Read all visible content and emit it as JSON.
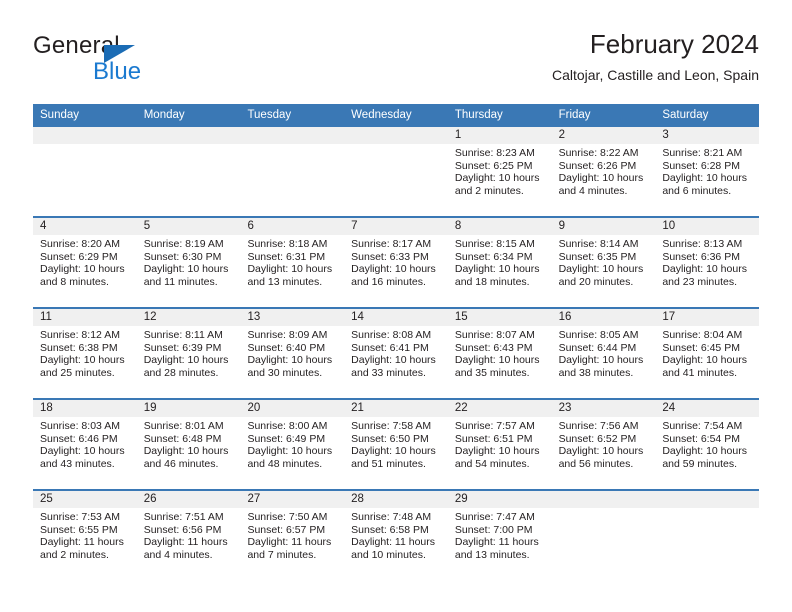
{
  "brand": {
    "name_top": "General",
    "name_bottom": "Blue",
    "triangle_color": "#1b6cb5",
    "blue_text_color": "#1b7ad0"
  },
  "header": {
    "title": "February 2024",
    "location": "Caltojar, Castille and Leon, Spain"
  },
  "theme": {
    "header_blue": "#3a78b5",
    "day_strip_gray": "#f0f0f0",
    "text_color": "#231f20"
  },
  "labels": {
    "sunrise_prefix": "Sunrise:",
    "sunset_prefix": "Sunset:",
    "daylight_prefix": "Daylight:"
  },
  "weekdays": [
    "Sunday",
    "Monday",
    "Tuesday",
    "Wednesday",
    "Thursday",
    "Friday",
    "Saturday"
  ],
  "weeks": [
    [
      {
        "day": "",
        "empty": true
      },
      {
        "day": "",
        "empty": true
      },
      {
        "day": "",
        "empty": true
      },
      {
        "day": "",
        "empty": true
      },
      {
        "day": "1",
        "sunrise": "Sunrise: 8:23 AM",
        "sunset": "Sunset: 6:25 PM",
        "daylight": "Daylight: 10 hours and 2 minutes."
      },
      {
        "day": "2",
        "sunrise": "Sunrise: 8:22 AM",
        "sunset": "Sunset: 6:26 PM",
        "daylight": "Daylight: 10 hours and 4 minutes."
      },
      {
        "day": "3",
        "sunrise": "Sunrise: 8:21 AM",
        "sunset": "Sunset: 6:28 PM",
        "daylight": "Daylight: 10 hours and 6 minutes."
      }
    ],
    [
      {
        "day": "4",
        "sunrise": "Sunrise: 8:20 AM",
        "sunset": "Sunset: 6:29 PM",
        "daylight": "Daylight: 10 hours and 8 minutes."
      },
      {
        "day": "5",
        "sunrise": "Sunrise: 8:19 AM",
        "sunset": "Sunset: 6:30 PM",
        "daylight": "Daylight: 10 hours and 11 minutes."
      },
      {
        "day": "6",
        "sunrise": "Sunrise: 8:18 AM",
        "sunset": "Sunset: 6:31 PM",
        "daylight": "Daylight: 10 hours and 13 minutes."
      },
      {
        "day": "7",
        "sunrise": "Sunrise: 8:17 AM",
        "sunset": "Sunset: 6:33 PM",
        "daylight": "Daylight: 10 hours and 16 minutes."
      },
      {
        "day": "8",
        "sunrise": "Sunrise: 8:15 AM",
        "sunset": "Sunset: 6:34 PM",
        "daylight": "Daylight: 10 hours and 18 minutes."
      },
      {
        "day": "9",
        "sunrise": "Sunrise: 8:14 AM",
        "sunset": "Sunset: 6:35 PM",
        "daylight": "Daylight: 10 hours and 20 minutes."
      },
      {
        "day": "10",
        "sunrise": "Sunrise: 8:13 AM",
        "sunset": "Sunset: 6:36 PM",
        "daylight": "Daylight: 10 hours and 23 minutes."
      }
    ],
    [
      {
        "day": "11",
        "sunrise": "Sunrise: 8:12 AM",
        "sunset": "Sunset: 6:38 PM",
        "daylight": "Daylight: 10 hours and 25 minutes."
      },
      {
        "day": "12",
        "sunrise": "Sunrise: 8:11 AM",
        "sunset": "Sunset: 6:39 PM",
        "daylight": "Daylight: 10 hours and 28 minutes."
      },
      {
        "day": "13",
        "sunrise": "Sunrise: 8:09 AM",
        "sunset": "Sunset: 6:40 PM",
        "daylight": "Daylight: 10 hours and 30 minutes."
      },
      {
        "day": "14",
        "sunrise": "Sunrise: 8:08 AM",
        "sunset": "Sunset: 6:41 PM",
        "daylight": "Daylight: 10 hours and 33 minutes."
      },
      {
        "day": "15",
        "sunrise": "Sunrise: 8:07 AM",
        "sunset": "Sunset: 6:43 PM",
        "daylight": "Daylight: 10 hours and 35 minutes."
      },
      {
        "day": "16",
        "sunrise": "Sunrise: 8:05 AM",
        "sunset": "Sunset: 6:44 PM",
        "daylight": "Daylight: 10 hours and 38 minutes."
      },
      {
        "day": "17",
        "sunrise": "Sunrise: 8:04 AM",
        "sunset": "Sunset: 6:45 PM",
        "daylight": "Daylight: 10 hours and 41 minutes."
      }
    ],
    [
      {
        "day": "18",
        "sunrise": "Sunrise: 8:03 AM",
        "sunset": "Sunset: 6:46 PM",
        "daylight": "Daylight: 10 hours and 43 minutes."
      },
      {
        "day": "19",
        "sunrise": "Sunrise: 8:01 AM",
        "sunset": "Sunset: 6:48 PM",
        "daylight": "Daylight: 10 hours and 46 minutes."
      },
      {
        "day": "20",
        "sunrise": "Sunrise: 8:00 AM",
        "sunset": "Sunset: 6:49 PM",
        "daylight": "Daylight: 10 hours and 48 minutes."
      },
      {
        "day": "21",
        "sunrise": "Sunrise: 7:58 AM",
        "sunset": "Sunset: 6:50 PM",
        "daylight": "Daylight: 10 hours and 51 minutes."
      },
      {
        "day": "22",
        "sunrise": "Sunrise: 7:57 AM",
        "sunset": "Sunset: 6:51 PM",
        "daylight": "Daylight: 10 hours and 54 minutes."
      },
      {
        "day": "23",
        "sunrise": "Sunrise: 7:56 AM",
        "sunset": "Sunset: 6:52 PM",
        "daylight": "Daylight: 10 hours and 56 minutes."
      },
      {
        "day": "24",
        "sunrise": "Sunrise: 7:54 AM",
        "sunset": "Sunset: 6:54 PM",
        "daylight": "Daylight: 10 hours and 59 minutes."
      }
    ],
    [
      {
        "day": "25",
        "sunrise": "Sunrise: 7:53 AM",
        "sunset": "Sunset: 6:55 PM",
        "daylight": "Daylight: 11 hours and 2 minutes."
      },
      {
        "day": "26",
        "sunrise": "Sunrise: 7:51 AM",
        "sunset": "Sunset: 6:56 PM",
        "daylight": "Daylight: 11 hours and 4 minutes."
      },
      {
        "day": "27",
        "sunrise": "Sunrise: 7:50 AM",
        "sunset": "Sunset: 6:57 PM",
        "daylight": "Daylight: 11 hours and 7 minutes."
      },
      {
        "day": "28",
        "sunrise": "Sunrise: 7:48 AM",
        "sunset": "Sunset: 6:58 PM",
        "daylight": "Daylight: 11 hours and 10 minutes."
      },
      {
        "day": "29",
        "sunrise": "Sunrise: 7:47 AM",
        "sunset": "Sunset: 7:00 PM",
        "daylight": "Daylight: 11 hours and 13 minutes."
      },
      {
        "day": "",
        "empty": true
      },
      {
        "day": "",
        "empty": true
      }
    ]
  ]
}
